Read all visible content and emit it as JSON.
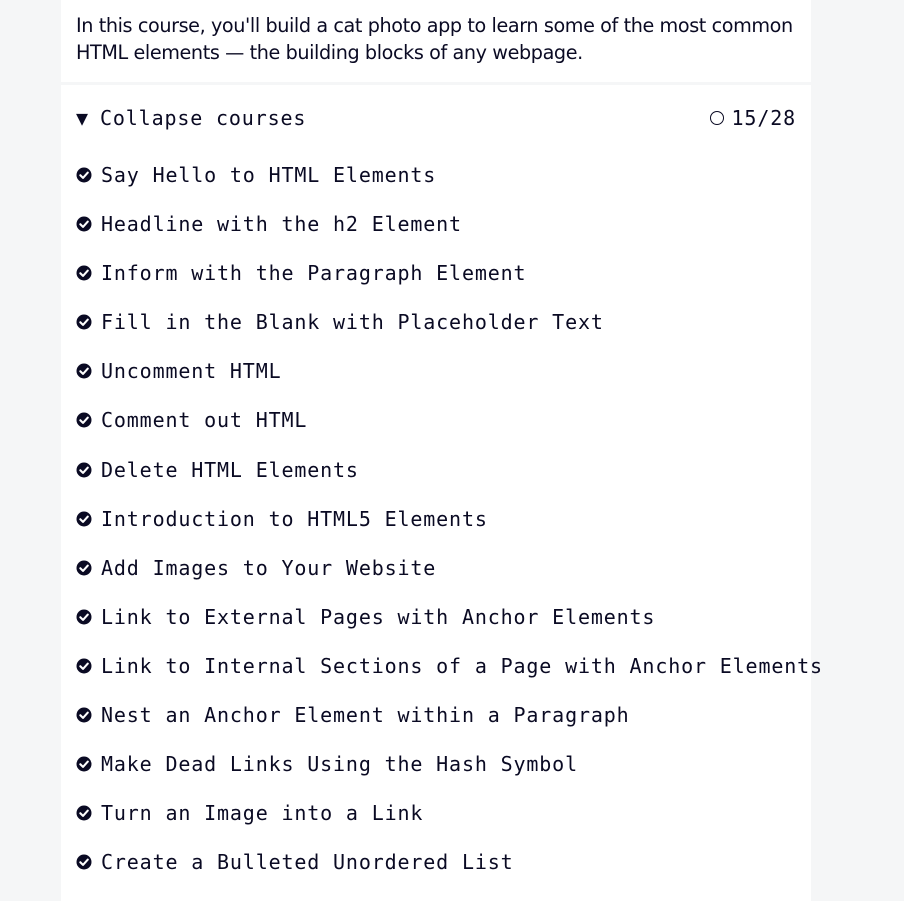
{
  "intro": {
    "text": "In this course, you'll build a cat photo app to learn some of the most common HTML elements — the building blocks of any webpage."
  },
  "courses": {
    "toggle_triangle": "▼",
    "toggle_label": "Collapse courses",
    "progress_text": "15/28",
    "lessons": [
      {
        "title": "Say Hello to HTML Elements",
        "status": "completed"
      },
      {
        "title": "Headline with the h2 Element",
        "status": "completed"
      },
      {
        "title": "Inform with the Paragraph Element",
        "status": "completed"
      },
      {
        "title": "Fill in the Blank with Placeholder Text",
        "status": "completed"
      },
      {
        "title": "Uncomment HTML",
        "status": "completed"
      },
      {
        "title": "Comment out HTML",
        "status": "completed"
      },
      {
        "title": "Delete HTML Elements",
        "status": "completed"
      },
      {
        "title": "Introduction to HTML5 Elements",
        "status": "completed"
      },
      {
        "title": "Add Images to Your Website",
        "status": "completed"
      },
      {
        "title": "Link to External Pages with Anchor Elements",
        "status": "completed"
      },
      {
        "title": "Link to Internal Sections of a Page with Anchor Elements",
        "status": "completed"
      },
      {
        "title": "Nest an Anchor Element within a Paragraph",
        "status": "completed"
      },
      {
        "title": "Make Dead Links Using the Hash Symbol",
        "status": "completed"
      },
      {
        "title": "Turn an Image into a Link",
        "status": "completed"
      },
      {
        "title": "Create a Bulleted Unordered List",
        "status": "completed"
      }
    ]
  },
  "icons": {
    "completed": "check-circle-icon",
    "progress": "circle-outline-icon"
  },
  "colors": {
    "text": "#0a0a23",
    "background": "#f5f6f7",
    "card": "#ffffff"
  }
}
